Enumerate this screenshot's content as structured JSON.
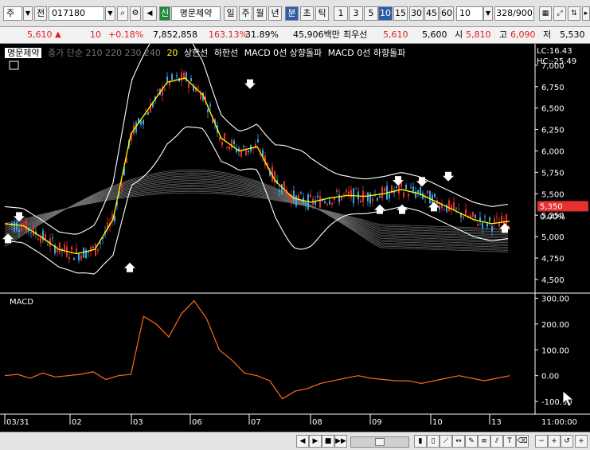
{
  "toolbar": {
    "market": "주",
    "prev_label": "전",
    "code": "017180",
    "badge": "신",
    "name": "명문제약",
    "period_buttons": [
      "일",
      "주",
      "월",
      "년",
      "분",
      "초",
      "틱"
    ],
    "interval_buttons": [
      "1",
      "3",
      "5",
      "10",
      "15",
      "30",
      "45",
      "60"
    ],
    "interval_select": "10",
    "count": "328/900"
  },
  "info": {
    "price": "5,610",
    "change": "10",
    "change_pct": "+0.18%",
    "volume": "7,852,858",
    "vol_ratio": "163.13%",
    "turnover": "31.89%",
    "amount": "45,906백만",
    "label_latest": "최우선",
    "latest": "5,610",
    "bid": "5,600",
    "label_open": "시",
    "open": "5,810",
    "label_high": "고",
    "high": "6,090",
    "label_low": "저",
    "low": "5,530"
  },
  "legend": {
    "stock": "명문제약",
    "ma": "종가 단순 210 220 230 240",
    "ma_hl": "20",
    "bb_upper": "상한선",
    "bb_lower": "하한선",
    "macd_up": "MACD 0선 상향돌파",
    "macd_down": "MACD 0선 하향돌파"
  },
  "price_axis": {
    "lc": "LC:16.43",
    "hc": "HC:-25.49",
    "ticks": [
      "7,000",
      "6,750",
      "6,500",
      "6,250",
      "6,000",
      "5,750",
      "5,500",
      "5,250",
      "5,000",
      "4,750",
      "4,500"
    ],
    "current": "5,350",
    "current_pct": "0.00%"
  },
  "macd_panel": {
    "label": "MACD",
    "ticks": [
      "300.00",
      "200.00",
      "100.00",
      "0.00",
      "-100.00"
    ]
  },
  "x_axis": {
    "labels": [
      "03/31",
      "02",
      "03",
      "06",
      "07",
      "08",
      "09",
      "10",
      "13"
    ],
    "time": "11:00:00"
  },
  "colors": {
    "bullish": "#e83030",
    "bearish": "#3aa8e8",
    "ma20": "#ffff00",
    "macd": "#ff6a1a",
    "accent": "#2b5da8"
  },
  "chart_data": {
    "type": "line",
    "series": [
      {
        "name": "MACD",
        "values": [
          0,
          5,
          -10,
          10,
          -5,
          0,
          5,
          15,
          -15,
          0,
          5,
          230,
          200,
          150,
          240,
          290,
          220,
          100,
          60,
          10,
          0,
          -20,
          -90,
          -60,
          -50,
          -30,
          -20,
          -10,
          0,
          -10,
          -15,
          -20,
          -20,
          -30,
          -20,
          -10,
          0,
          -10,
          -20,
          -10,
          0
        ]
      },
      {
        "name": "20",
        "values": [
          5150,
          5130,
          5000,
          4850,
          4800,
          4850,
          5200,
          6200,
          6500,
          6800,
          6850,
          6650,
          6150,
          6000,
          6050,
          5650,
          5450,
          5400,
          5450,
          5480,
          5470,
          5500,
          5550,
          5500,
          5400,
          5300,
          5200,
          5150,
          5180
        ]
      }
    ],
    "ylim_price": [
      4350,
      7250
    ],
    "ylim_macd": [
      -140,
      320
    ]
  }
}
